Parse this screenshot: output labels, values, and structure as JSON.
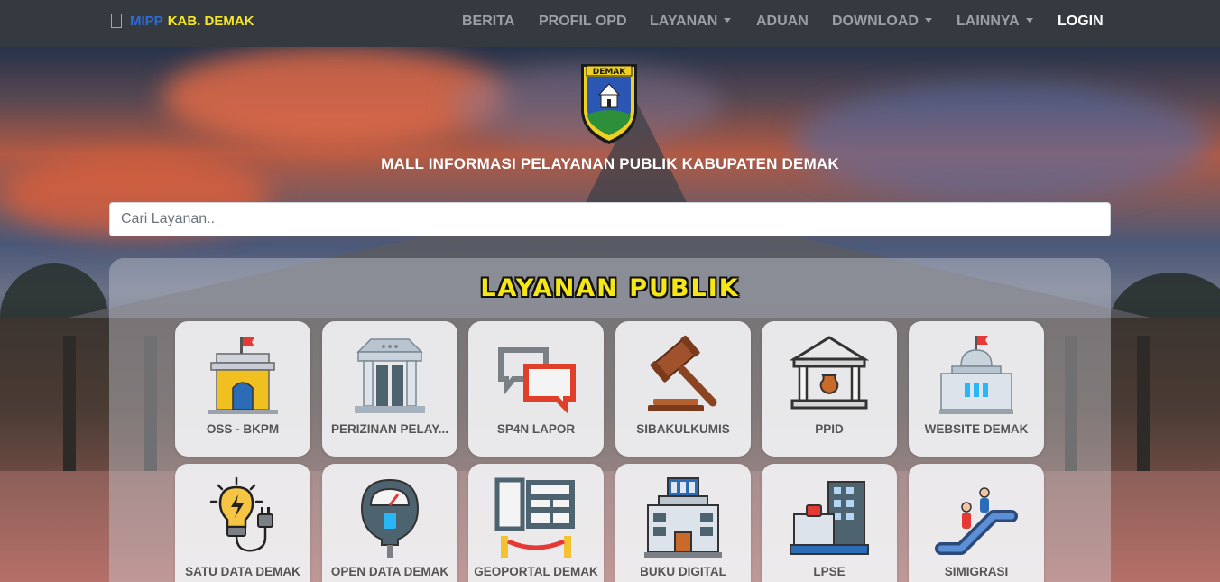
{
  "navbar": {
    "brand_part1": "MIPP",
    "brand_part2": "KAB. DEMAK",
    "items": [
      {
        "label": "BERITA"
      },
      {
        "label": "PROFIL OPD"
      },
      {
        "label": "LAYANAN"
      },
      {
        "label": "ADUAN"
      },
      {
        "label": "DOWNLOAD"
      },
      {
        "label": "LAINNYA"
      },
      {
        "label": "LOGIN"
      }
    ]
  },
  "hero": {
    "logo_text": "DEMAK",
    "title": "MALL INFORMASI PELAYANAN PUBLIK KABUPATEN DEMAK"
  },
  "search": {
    "placeholder": "Cari Layanan.."
  },
  "panel": {
    "title": "LAYANAN PUBLIK",
    "services": [
      {
        "label": "OSS - BKPM",
        "icon": "government-building-flag-icon"
      },
      {
        "label": "PERIZINAN PELAY...",
        "icon": "columns-building-icon"
      },
      {
        "label": "SP4N LAPOR",
        "icon": "chat-bubbles-icon"
      },
      {
        "label": "SIBAKULKUMIS",
        "icon": "gavel-icon"
      },
      {
        "label": "PPID",
        "icon": "museum-vase-icon"
      },
      {
        "label": "WEBSITE DEMAK",
        "icon": "dome-building-flag-icon"
      },
      {
        "label": "SATU DATA DEMAK",
        "icon": "lightbulb-plug-icon"
      },
      {
        "label": "OPEN DATA DEMAK",
        "icon": "parking-meter-icon"
      },
      {
        "label": "GEOPORTAL DEMAK",
        "icon": "exhibit-panels-icon"
      },
      {
        "label": "BUKU DIGITAL",
        "icon": "library-building-icon"
      },
      {
        "label": "LPSE",
        "icon": "office-building-bag-icon"
      },
      {
        "label": "SIMIGRASI",
        "icon": "escalator-icon"
      }
    ]
  },
  "colors": {
    "navbar_bg": "#343a40",
    "brand_blue": "#2f6bd8",
    "brand_yellow": "#f5e62a",
    "title_yellow": "#f5e615"
  }
}
